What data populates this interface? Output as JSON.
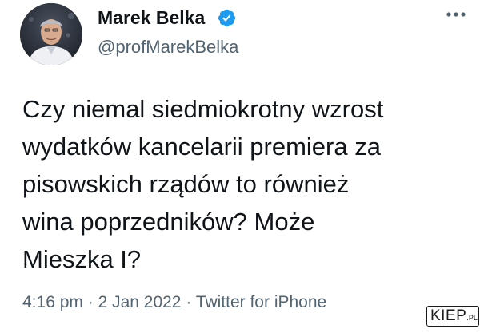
{
  "author": {
    "name": "Marek Belka",
    "handle": "@profMarekBelka",
    "verified": true
  },
  "tweet": {
    "text_lines": [
      "Czy niemal siedmiokrotny wzrost",
      "wydatków kancelarii premiera za",
      "pisowskich rządów to również",
      "wina poprzedników? Może",
      "Mieszka I?"
    ]
  },
  "meta": {
    "time": "4:16 pm",
    "separator": " · ",
    "date": "2 Jan 2022",
    "source": "Twitter for iPhone"
  },
  "watermark": {
    "main": "KIEP",
    "sub": ".PL"
  },
  "icons": {
    "verified": "verified-badge-icon",
    "more": "more-horizontal-icon"
  },
  "colors": {
    "text": "#0f1419",
    "secondary": "#536471",
    "verified": "#1d9bf0"
  }
}
